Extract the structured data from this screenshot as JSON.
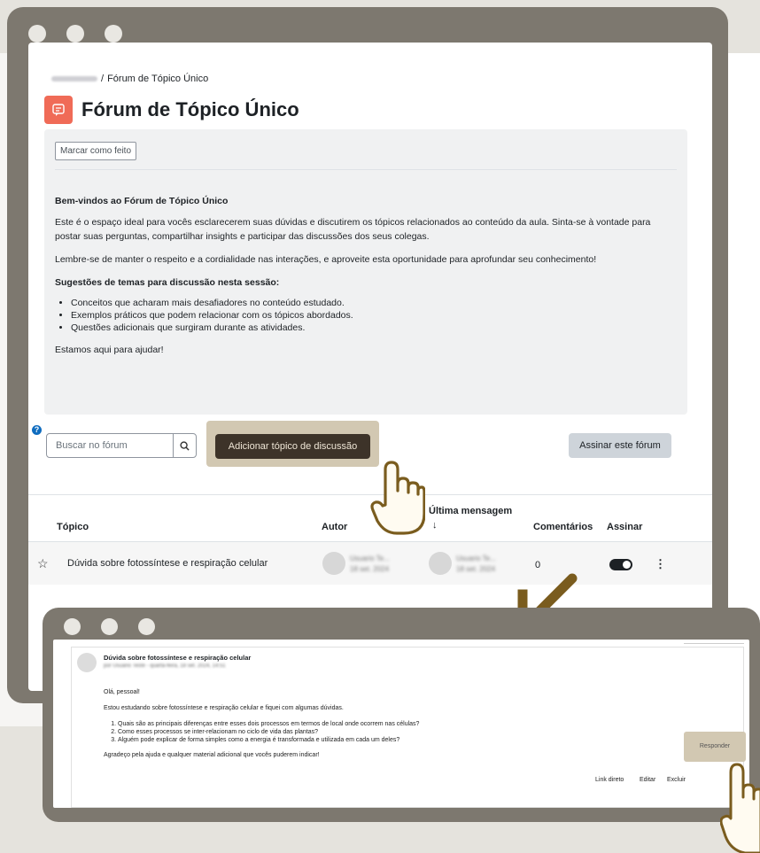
{
  "page": {
    "breadcrumb_current": "Fórum de Tópico Único",
    "breadcrumb_separator": "/",
    "title": "Fórum de Tópico Único"
  },
  "activity": {
    "mark_done_label": "Marcar como feito"
  },
  "description": {
    "heading": "Bem-vindos ao Fórum de Tópico Único",
    "para1": "Este é o espaço ideal para vocês esclarecerem suas dúvidas e discutirem os tópicos relacionados ao conteúdo da aula. Sinta-se à vontade para postar suas perguntas, compartilhar insights e participar das discussões dos seus colegas.",
    "para2": "Lembre-se de manter o respeito e a cordialidade nas interações, e aproveite esta oportunidade para aprofundar seu conhecimento!",
    "subheading": "Sugestões de temas para discussão nesta sessão:",
    "suggestions": [
      "Conceitos que acharam mais desafiadores no conteúdo estudado.",
      "Exemplos práticos que podem relacionar com os tópicos abordados.",
      "Questões adicionais que surgiram durante as atividades."
    ],
    "closing": "Estamos aqui para ajudar!"
  },
  "toolbar": {
    "search_placeholder": "Buscar no fórum",
    "add_topic_label": "Adicionar tópico de discussão",
    "subscribe_label": "Assinar este fórum"
  },
  "table": {
    "headers": {
      "topic": "Tópico",
      "author": "Autor",
      "last_post": "Última mensagem",
      "last_post_sort": "↓",
      "comments": "Comentários",
      "subscribe": "Assinar"
    },
    "rows": [
      {
        "topic": "Dúvida sobre fotossíntese e respiração celular",
        "author_name": "Usuario Te...",
        "author_date": "18 set. 2024",
        "last_name": "Usuario Te...",
        "last_date": "18 set. 2024",
        "comments": "0",
        "subscribed": true
      }
    ]
  },
  "post": {
    "title": "Dúvida sobre fotossíntese e respiração celular",
    "author_line": "por Usuario Teste - quarta-feira, 18 set. 2024, 14:51",
    "greeting": "Olá, pessoal!",
    "intro": "Estou estudando sobre fotossíntese e respiração celular e fiquei com algumas dúvidas.",
    "questions": [
      "Quais são as principais diferenças entre esses dois processos em termos de local onde ocorrem nas células?",
      "Como esses processos se inter-relacionam no ciclo de vida das plantas?",
      "Alguém pode explicar de forma simples como a energia é transformada e utilizada em cada um deles?"
    ],
    "thanks": "Agradeço pela ajuda e qualquer material adicional que vocês puderem indicar!",
    "links": {
      "permalink": "Link direto",
      "edit": "Editar",
      "delete": "Excluir",
      "reply": "Responder"
    }
  },
  "colors": {
    "window_frame": "#7d786f",
    "accent_dark": "#3d3329",
    "highlight": "#d2c8b2",
    "pointer": "#7a5c1e",
    "forum_icon": "#f06b57"
  }
}
